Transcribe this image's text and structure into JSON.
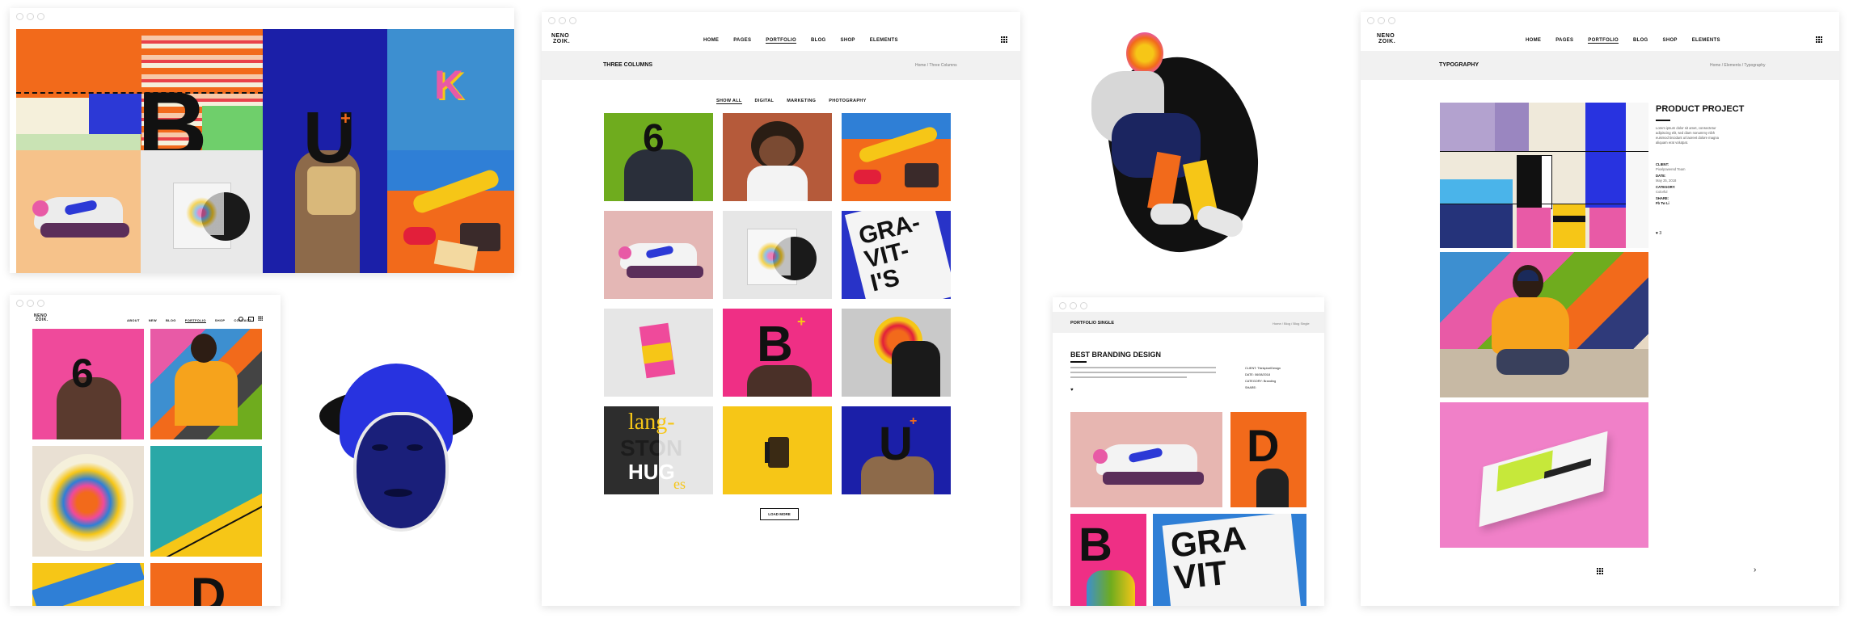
{
  "logo": {
    "line1": "NENO",
    "line2": "ZOIK."
  },
  "nav_main": [
    "HOME",
    "PAGES",
    "PORTFOLIO",
    "BLOG",
    "SHOP",
    "ELEMENTS"
  ],
  "nav_small": [
    "ABOUT",
    "NEW",
    "BLOG",
    "PORTFOLIO",
    "SHOP",
    "CONTACT"
  ],
  "three_columns": {
    "title": "THREE COLUMNS",
    "breadcrumb": "Home / Three Columns",
    "filters": [
      "SHOW ALL",
      "DIGITAL",
      "MARKETING",
      "PHOTOGRAPHY"
    ],
    "load_more": "LOAD MORE",
    "tile_text": {
      "six": "6",
      "gravity": "GRA-VIT-I'S",
      "b": "B",
      "lang_top": "lang-",
      "lang_mid": "STON",
      "lang_bot": "HUG",
      "lang_es": "es",
      "u": "U"
    }
  },
  "collage": {
    "b": "B",
    "u": "U",
    "k": "K"
  },
  "left_site": {
    "six": "6",
    "d": "D"
  },
  "single": {
    "header": "PORTFOLIO SINGLE",
    "breadcrumb": "Home / Blog / Blog Single",
    "title": "BEST BRANDING DESIGN",
    "meta": [
      "CLIENT: ThinkpixelDesign",
      "DATE: 06/08/2018",
      "CATEGORY: Branding",
      "SHARE:"
    ],
    "tile_b": "B",
    "tile_grav": "GRA VIT"
  },
  "typography": {
    "header": "TYPOGRAPHY",
    "breadcrumb": "Home / Elements / Typography",
    "project_title": "PRODUCT PROJECT",
    "project_text": "Lorem ipsum dolor sit amet, consectetur adipiscing elit, sed diam nonummy nibh euismod tincidunt ut laoreet dolore magna aliquam erat volutpat.",
    "meta_labels": [
      "CLIENT:",
      "DATE:",
      "CATEGORY:",
      "SHARE:"
    ],
    "meta_values": [
      "Pixelpowered Team",
      "May 25, 2018",
      "Colorful",
      "Fb  Tw  Li"
    ],
    "likes": "3"
  },
  "colors": {
    "orange": "#f26a1b",
    "navy": "#1b1fa8",
    "pink": "#ef3b84",
    "yellow": "#f6c617",
    "green": "#6fac1e",
    "blue": "#3d8fd0",
    "magenta": "#e85aa6"
  }
}
